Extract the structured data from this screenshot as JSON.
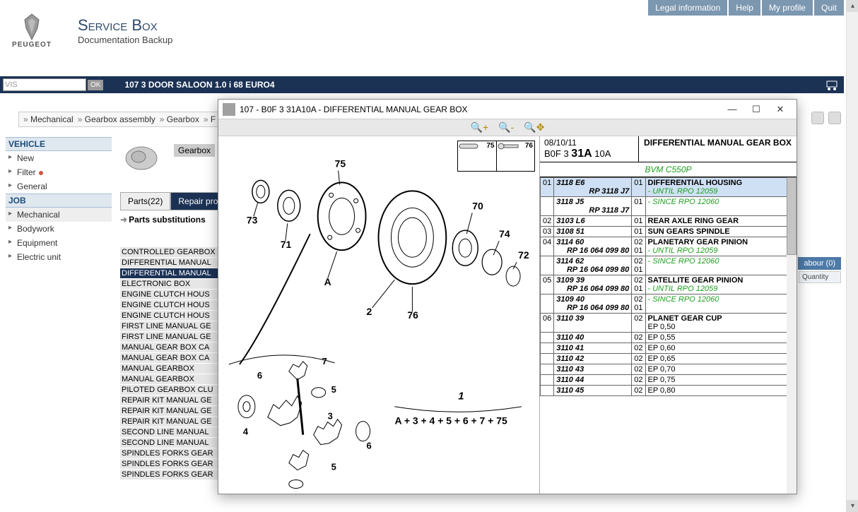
{
  "topnav": [
    "Legal information",
    "Help",
    "My profile",
    "Quit"
  ],
  "brand": {
    "name": "PEUGEOT",
    "t1": "Service Box",
    "t2": "Documentation Backup"
  },
  "darkbar": {
    "vis": "VIS",
    "ok": "OK",
    "vehicle": "107 3 DOOR SALOON 1.0 i 68 EURO4"
  },
  "crumb": [
    "Mechanical",
    "Gearbox assembly",
    "Gearbox",
    "F"
  ],
  "sidebar": {
    "vehicle_hdr": "VEHICLE",
    "vehicle_items": [
      "New",
      "Filter",
      "General"
    ],
    "job_hdr": "JOB",
    "job_items": [
      "Mechanical",
      "Bodywork",
      "Equipment",
      "Electric unit"
    ]
  },
  "gearbox_label": "Gearbox",
  "tabs": {
    "parts": "Parts(22)",
    "repair": "Repair proc"
  },
  "parts_substitutions": "Parts substitutions",
  "itemlist": [
    "CONTROLLED GEARBOX",
    "DIFFERENTIAL MANUAL",
    "DIFFERENTIAL MANUAL",
    "ELECTRONIC BOX",
    "ENGINE CLUTCH HOUS",
    "ENGINE CLUTCH HOUS",
    "ENGINE CLUTCH HOUS",
    "FIRST LINE MANUAL GE",
    "FIRST LINE MANUAL GE",
    "MANUAL GEAR BOX CA",
    "MANUAL GEAR BOX CA",
    "MANUAL GEARBOX",
    "MANUAL GEARBOX",
    "PILOTED GEARBOX CLU",
    "REPAIR KIT MANUAL GE",
    "REPAIR KIT MANUAL GE",
    "REPAIR KIT MANUAL GE",
    "SECOND LINE MANUAL",
    "SECOND LINE MANUAL",
    "SPINDLES FORKS GEAR",
    "SPINDLES FORKS GEAR",
    "SPINDLES FORKS GEAR"
  ],
  "itemlist_selected_index": 2,
  "basket": {
    "tab": "abour (0)",
    "head": "Quantity"
  },
  "modal": {
    "title": "107 - B0F 3 31A10A - DIFFERENTIAL MANUAL GEAR BOX",
    "date": "08/10/11",
    "code_pre": "B0F 3 ",
    "code_bold": "31A",
    "code_post": " 10A",
    "heading": "DIFFERENTIAL MANUAL GEAR BOX",
    "bvm": "BVM C550P",
    "callout75": "75",
    "callout76": "76",
    "formula": "A + 3 + 4 + 5 + 6 + 7 + 75",
    "formula_idx": "1",
    "diagram_labels": {
      "l75": "75",
      "l73": "73",
      "l71": "71",
      "lA": "A",
      "l2": "2",
      "l70": "70",
      "l74": "74",
      "l72": "72",
      "l76": "76",
      "l6a": "6",
      "l7a": "7",
      "l4a": "4",
      "l5a": "5",
      "l3": "3",
      "l6b": "6",
      "l5b": "5"
    },
    "rows": [
      {
        "n": "01",
        "ref": "3118 E6",
        "rp": "RP 3118 J7",
        "q": "01",
        "desc": "DIFFERENTIAL HOUSING",
        "note": "- UNTIL RPO 12059",
        "hl": true
      },
      {
        "n": "",
        "ref": "3118 J5",
        "rp": "RP 3118 J7",
        "q": "01",
        "desc": "",
        "note": "- SINCE RPO 12060"
      },
      {
        "n": "02",
        "ref": "3103 L6",
        "q": "01",
        "desc": "REAR AXLE RING GEAR"
      },
      {
        "n": "03",
        "ref": "3108 51",
        "q": "01",
        "desc": "SUN GEARS SPINDLE"
      },
      {
        "n": "04",
        "ref": "3114 60",
        "rp": "RP 16 064 099 80",
        "q": "02",
        "q2": "01",
        "desc": "PLANETARY GEAR PINION",
        "note": "- UNTIL RPO 12059"
      },
      {
        "n": "",
        "ref": "3114 62",
        "rp": "RP 16 064 099 80",
        "q": "02",
        "q2": "01",
        "desc": "",
        "note": "- SINCE RPO 12060"
      },
      {
        "n": "05",
        "ref": "3109 39",
        "rp": "RP 16 064 099 80",
        "q": "02",
        "q2": "01",
        "desc": "SATELLITE GEAR PINION",
        "note": "- UNTIL RPO 12059"
      },
      {
        "n": "",
        "ref": "3109 40",
        "rp": "RP 16 064 099 80",
        "q": "02",
        "q2": "01",
        "desc": "",
        "note": "- SINCE RPO 12060"
      },
      {
        "n": "06",
        "ref": "3110 39",
        "q": "02",
        "desc": "PLANET GEAR CUP",
        "ep": "EP 0,50"
      },
      {
        "n": "",
        "ref": "3110 40",
        "q": "02",
        "ep": "EP 0,55"
      },
      {
        "n": "",
        "ref": "3110 41",
        "q": "02",
        "ep": "EP 0,60"
      },
      {
        "n": "",
        "ref": "3110 42",
        "q": "02",
        "ep": "EP 0,65"
      },
      {
        "n": "",
        "ref": "3110 43",
        "q": "02",
        "ep": "EP 0,70"
      },
      {
        "n": "",
        "ref": "3110 44",
        "q": "02",
        "ep": "EP 0,75"
      },
      {
        "n": "",
        "ref": "3110 45",
        "q": "02",
        "ep": "EP 0,80"
      }
    ]
  }
}
